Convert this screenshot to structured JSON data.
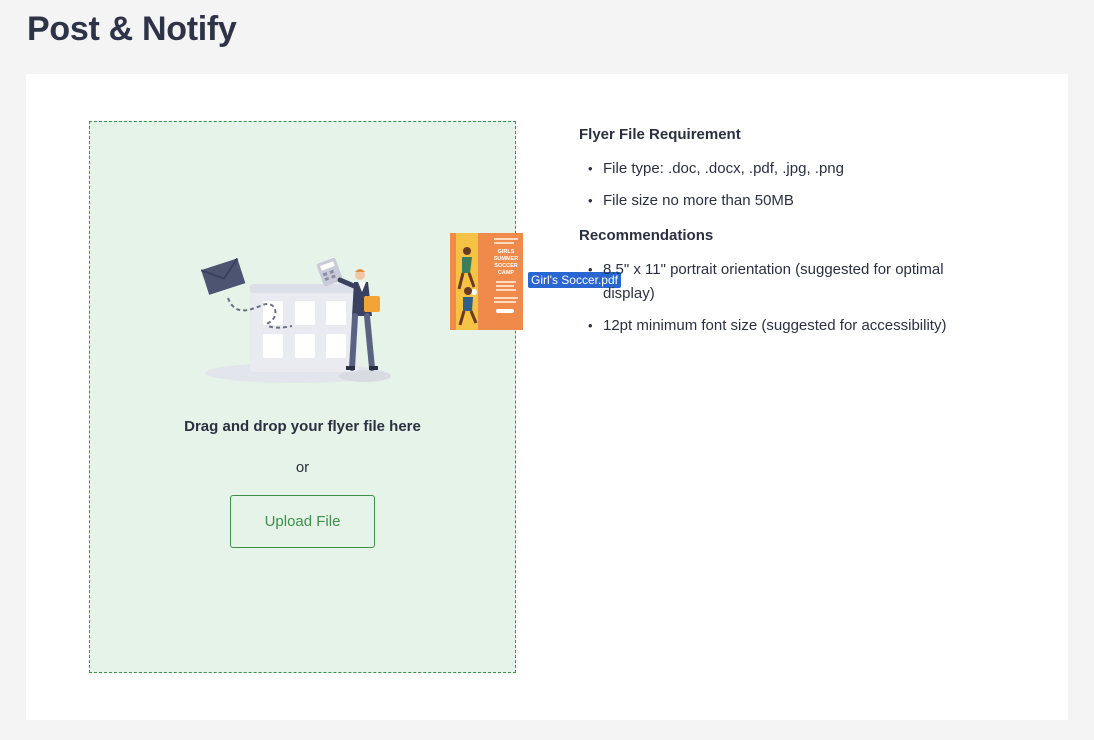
{
  "header": {
    "title": "Post & Notify"
  },
  "dropzone": {
    "instruction": "Drag and drop your flyer file here",
    "or_text": "or",
    "upload_label": "Upload File",
    "dragging_file": {
      "name": "Girl's Soccer.pdf",
      "thumb_title_lines": [
        "GIRLS",
        "SUMMER",
        "SOCCER",
        "CAMP"
      ]
    }
  },
  "requirements": {
    "title": "Flyer File Requirement",
    "items": [
      "File type: .doc, .docx, .pdf, .jpg, .png",
      "File size no more than 50MB"
    ]
  },
  "recommendations": {
    "title": "Recommendations",
    "items": [
      "8.5\" x 11\" portrait orientation (suggested for optimal display)",
      "12pt minimum font size (suggested for accessibility)"
    ]
  },
  "colors": {
    "accent_green": "#3f8f4a",
    "dropzone_bg": "#e6f3e8",
    "drag_label_bg": "#2a66d0",
    "flyer_orange": "#f08a4b"
  }
}
